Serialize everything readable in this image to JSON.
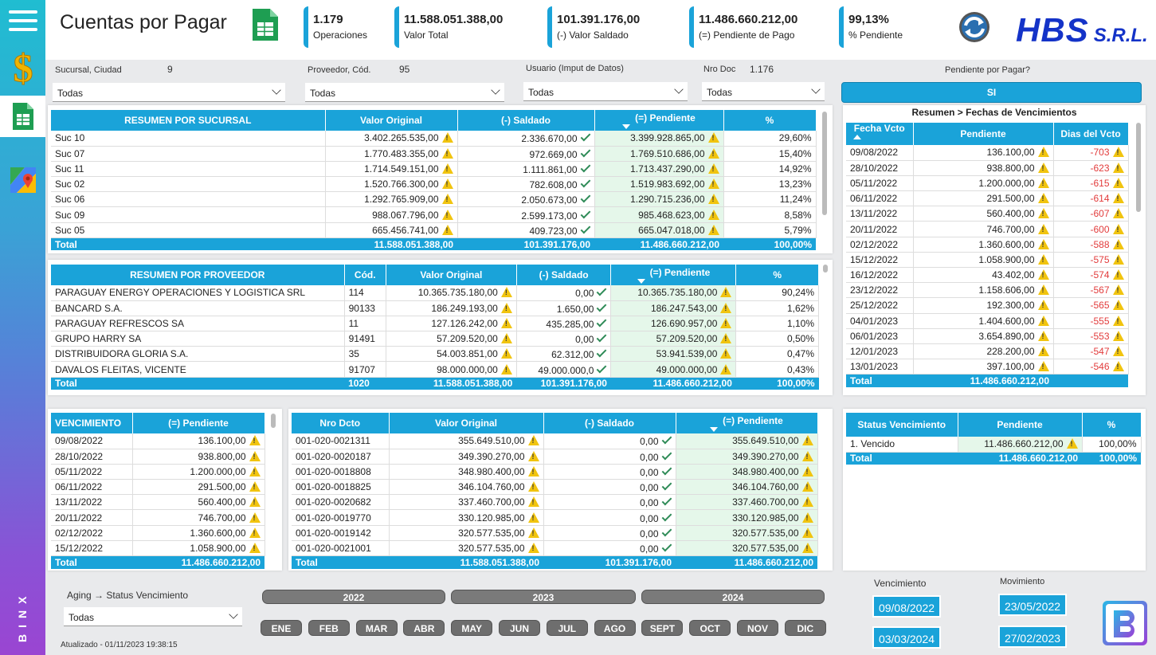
{
  "header": {
    "title": "Cuentas por Pagar",
    "kpis": [
      {
        "value": "1.179",
        "label": "Operaciones"
      },
      {
        "value": "11.588.051.388,00",
        "label": "Valor Total"
      },
      {
        "value": "101.391.176,00",
        "label": "(-) Valor Saldado"
      },
      {
        "value": "11.486.660.212,00",
        "label": "(=) Pendiente de Pago"
      },
      {
        "value": "99,13%",
        "label": "% Pendiente"
      }
    ],
    "logo_text": "HBS",
    "logo_suffix": "S.R.L."
  },
  "filters": {
    "sucursal": {
      "label": "Sucursal, Ciudad",
      "count": "9",
      "value": "Todas"
    },
    "proveedor": {
      "label": "Proveedor, Cód.",
      "count": "95",
      "value": "Todas"
    },
    "usuario": {
      "label": "Usuario (Imput de Datos)",
      "value": "Todas"
    },
    "nrodoc": {
      "label": "Nro Doc",
      "count": "1.176",
      "value": "Todas"
    },
    "pendiente": {
      "label": "Pendiente por Pagar?",
      "value": "SI"
    }
  },
  "sucursal_table": {
    "headers": [
      "RESUMEN POR SUCURSAL",
      "Valor Original",
      "(-) Saldado",
      "(=) Pendiente",
      "%"
    ],
    "rows": [
      [
        "Suc 10",
        "3.402.265.535,00",
        "2.336.670,00",
        "3.399.928.865,00",
        "29,60%"
      ],
      [
        "Suc 07",
        "1.770.483.355,00",
        "972.669,00",
        "1.769.510.686,00",
        "15,40%"
      ],
      [
        "Suc 11",
        "1.714.549.151,00",
        "1.111.861,00",
        "1.713.437.290,00",
        "14,92%"
      ],
      [
        "Suc 02",
        "1.520.766.300,00",
        "782.608,00",
        "1.519.983.692,00",
        "13,23%"
      ],
      [
        "Suc 06",
        "1.292.765.909,00",
        "2.050.673,00",
        "1.290.715.236,00",
        "11,24%"
      ],
      [
        "Suc 09",
        "988.067.796,00",
        "2.599.173,00",
        "985.468.623,00",
        "8,58%"
      ],
      [
        "Suc 05",
        "665.456.741,00",
        "409.723,00",
        "665.047.018,00",
        "5,79%"
      ]
    ],
    "total": [
      "Total",
      "11.588.051.388,00",
      "101.391.176,00",
      "11.486.660.212,00",
      "100,00%"
    ]
  },
  "proveedor_table": {
    "headers": [
      "RESUMEN POR PROVEEDOR",
      "Cód.",
      "Valor Original",
      "(-) Saldado",
      "(=) Pendiente",
      "%"
    ],
    "rows": [
      [
        "PARAGUAY ENERGY OPERACIONES Y LOGISTICA SRL",
        "114",
        "10.365.735.180,00",
        "0,00",
        "10.365.735.180,00",
        "90,24%"
      ],
      [
        "BANCARD S.A.",
        "90133",
        "186.249.193,00",
        "1.650,00",
        "186.247.543,00",
        "1,62%"
      ],
      [
        "PARAGUAY REFRESCOS SA",
        "11",
        "127.126.242,00",
        "435.285,00",
        "126.690.957,00",
        "1,10%"
      ],
      [
        "GRUPO HARRY SA",
        "91491",
        "57.209.520,00",
        "0,00",
        "57.209.520,00",
        "0,50%"
      ],
      [
        "DISTRIBUIDORA GLORIA S.A.",
        "35",
        "54.003.851,00",
        "62.312,00",
        "53.941.539,00",
        "0,47%"
      ],
      [
        "DAVALOS FLEITAS, VICENTE",
        "91707",
        "98.000.000,00",
        "49.000.000,0",
        "49.000.000,00",
        "0,43%"
      ]
    ],
    "total": [
      "Total",
      "1020",
      "11.588.051.388,00",
      "101.391.176,00",
      "11.486.660.212,00",
      "100,00%"
    ]
  },
  "fechas_table": {
    "title": "Resumen > Fechas de Vencimientos",
    "headers": [
      "Fecha Vcto",
      "Pendiente",
      "Dias del Vcto"
    ],
    "rows": [
      [
        "09/08/2022",
        "136.100,00",
        "-703"
      ],
      [
        "28/10/2022",
        "938.800,00",
        "-623"
      ],
      [
        "05/11/2022",
        "1.200.000,00",
        "-615"
      ],
      [
        "06/11/2022",
        "291.500,00",
        "-614"
      ],
      [
        "13/11/2022",
        "560.400,00",
        "-607"
      ],
      [
        "20/11/2022",
        "746.700,00",
        "-600"
      ],
      [
        "02/12/2022",
        "1.360.600,00",
        "-588"
      ],
      [
        "15/12/2022",
        "1.058.900,00",
        "-575"
      ],
      [
        "16/12/2022",
        "43.402,00",
        "-574"
      ],
      [
        "23/12/2022",
        "1.158.606,00",
        "-567"
      ],
      [
        "25/12/2022",
        "192.300,00",
        "-565"
      ],
      [
        "04/01/2023",
        "1.404.600,00",
        "-555"
      ],
      [
        "06/01/2023",
        "3.654.890,00",
        "-553"
      ],
      [
        "12/01/2023",
        "228.200,00",
        "-547"
      ],
      [
        "13/01/2023",
        "397.100,00",
        "-546"
      ]
    ],
    "total": [
      "Total",
      "11.486.660.212,00",
      ""
    ]
  },
  "vencimiento_table": {
    "headers": [
      "VENCIMIENTO",
      "(=) Pendiente"
    ],
    "rows": [
      [
        "09/08/2022",
        "136.100,00"
      ],
      [
        "28/10/2022",
        "938.800,00"
      ],
      [
        "05/11/2022",
        "1.200.000,00"
      ],
      [
        "06/11/2022",
        "291.500,00"
      ],
      [
        "13/11/2022",
        "560.400,00"
      ],
      [
        "20/11/2022",
        "746.700,00"
      ],
      [
        "02/12/2022",
        "1.360.600,00"
      ],
      [
        "15/12/2022",
        "1.058.900,00"
      ]
    ],
    "total": [
      "Total",
      "11.486.660.212,00"
    ]
  },
  "docto_table": {
    "headers": [
      "Nro Dcto",
      "Valor Original",
      "(-) Saldado",
      "(=) Pendiente"
    ],
    "rows": [
      [
        "001-020-0021311",
        "355.649.510,00",
        "0,00",
        "355.649.510,00"
      ],
      [
        "001-020-0020187",
        "349.390.270,00",
        "0,00",
        "349.390.270,00"
      ],
      [
        "001-020-0018808",
        "348.980.400,00",
        "0,00",
        "348.980.400,00"
      ],
      [
        "001-020-0018825",
        "346.104.760,00",
        "0,00",
        "346.104.760,00"
      ],
      [
        "001-020-0020682",
        "337.460.700,00",
        "0,00",
        "337.460.700,00"
      ],
      [
        "001-020-0019770",
        "330.120.985,00",
        "0,00",
        "330.120.985,00"
      ],
      [
        "001-020-0019142",
        "320.577.535,00",
        "0,00",
        "320.577.535,00"
      ],
      [
        "001-020-0021001",
        "320.577.535,00",
        "0,00",
        "320.577.535,00"
      ]
    ],
    "total": [
      "Total",
      "11.588.051.388,00",
      "101.391.176,00",
      "11.486.660.212,00"
    ]
  },
  "status_table": {
    "headers": [
      "Status Vencimiento",
      "Pendiente",
      "%"
    ],
    "rows": [
      [
        "1. Vencido",
        "11.486.660.212,00",
        "100,00%"
      ]
    ],
    "total": [
      "Total",
      "11.486.660.212,00",
      "100,00%"
    ]
  },
  "aging": {
    "label": "Aging → Status Vencimiento",
    "value": "Todas"
  },
  "updated": "Atualizado - 01/11/2023 19:38:15",
  "years": [
    "2022",
    "2023",
    "2024"
  ],
  "months": [
    "ENE",
    "FEB",
    "MAR",
    "ABR",
    "MAY",
    "JUN",
    "JUL",
    "AGO",
    "SEPT",
    "OCT",
    "NOV",
    "DIC"
  ],
  "dates": {
    "vencimiento_label": "Vencimiento",
    "movimiento_label": "Movimiento",
    "venc_from": "09/08/2022",
    "venc_to": "03/03/2024",
    "mov_from": "23/05/2022",
    "mov_to": "27/02/2023"
  },
  "sidebar": {
    "brand": "BINX"
  },
  "colors": {
    "accent": "#1aa3d9",
    "pendiente_bg": "#e5f7ea",
    "negative": "#e23b3b",
    "warning": "#f1c40f",
    "ok": "#2e8b57",
    "logo": "#1433c8"
  }
}
